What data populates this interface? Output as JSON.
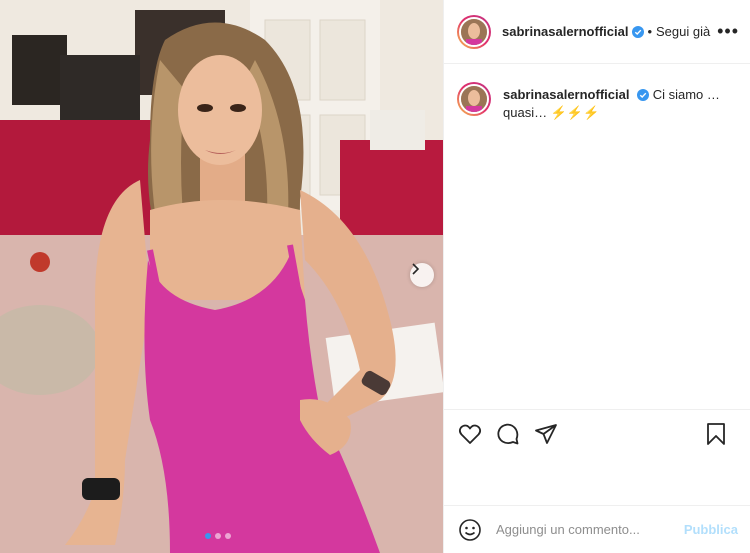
{
  "post": {
    "username": "sabrinasalernofficial",
    "separator": "•",
    "follow_label": "Segui già",
    "more_label": "•••",
    "caption_text": "Ci siamo … quasi… ⚡⚡⚡",
    "carousel_count": 3,
    "carousel_active_index": 0
  },
  "comment": {
    "placeholder": "Aggiungi un commento...",
    "publish_label": "Pubblica"
  },
  "icons": {
    "avatar": "avatar-photo",
    "verified": "verified-badge-icon",
    "more": "more-options-icon",
    "next": "chevron-right-icon",
    "like": "heart-icon",
    "comment": "comment-bubble-icon",
    "share": "paper-plane-icon",
    "save": "bookmark-icon",
    "emoji": "smiley-icon"
  },
  "colors": {
    "accent_blue": "#3897f0",
    "verified_blue": "#3897f0",
    "publish_disabled": "#b2dffc",
    "dress_pink": "#d4389e"
  }
}
